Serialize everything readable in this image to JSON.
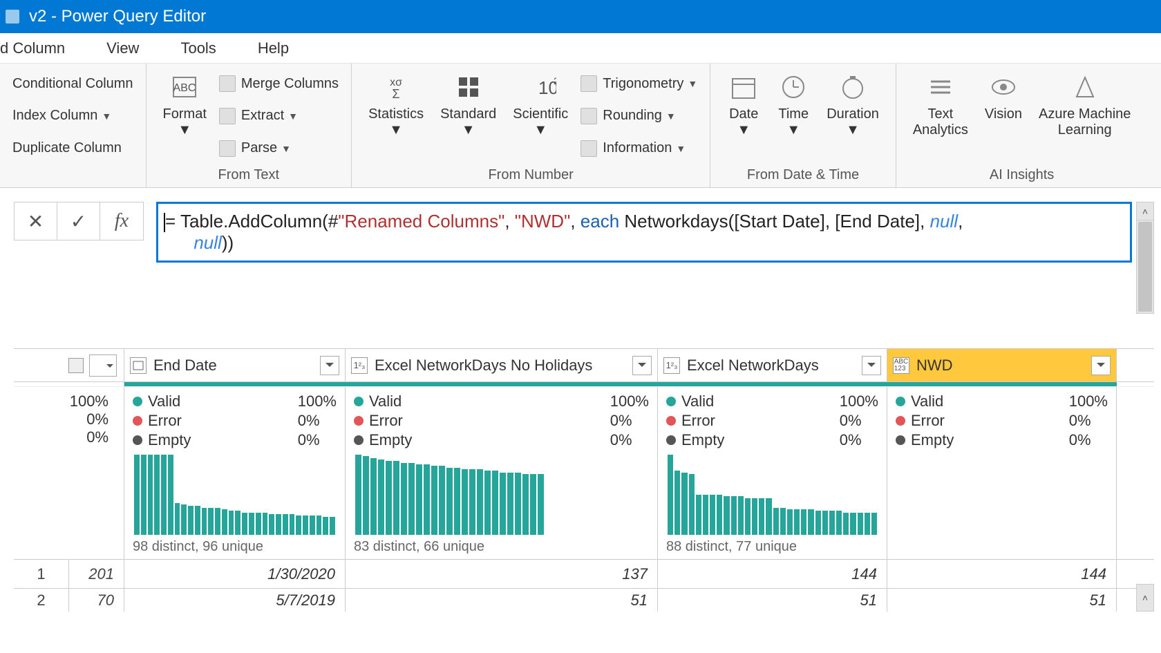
{
  "window": {
    "title": "v2 - Power Query Editor"
  },
  "menu": {
    "items": [
      "d Column",
      "View",
      "Tools",
      "Help"
    ]
  },
  "ribbon": {
    "col_group": {
      "conditional": "Conditional Column",
      "index": "Index Column",
      "duplicate": "Duplicate Column"
    },
    "text_group": {
      "format": "Format",
      "merge": "Merge Columns",
      "extract": "Extract",
      "parse": "Parse",
      "label": "From Text"
    },
    "number_group": {
      "statistics": "Statistics",
      "standard": "Standard",
      "scientific": "Scientific",
      "trig": "Trigonometry",
      "rounding": "Rounding",
      "information": "Information",
      "label": "From Number"
    },
    "datetime_group": {
      "date": "Date",
      "time": "Time",
      "duration": "Duration",
      "label": "From Date & Time"
    },
    "ai_group": {
      "ta": "Text\nAnalytics",
      "vision": "Vision",
      "aml": "Azure Machine\nLearning",
      "label": "AI Insights"
    }
  },
  "formula": {
    "pre": "= Table.AddColumn(#",
    "step_name": "\"Renamed Columns\"",
    "mid1": ", ",
    "new_col": "\"NWD\"",
    "mid2": ", ",
    "each_kw": "each",
    "mid3": " Networkdays([Start Date], [End Date], ",
    "null1": "null",
    "mid4": ",\n      ",
    "null2": "null",
    "tail": "))"
  },
  "columns": [
    {
      "type": "date",
      "name": "End Date",
      "valid_pct": "100%",
      "error_pct": "0%",
      "empty_pct": "0%",
      "distinct": "98 distinct, 96 unique"
    },
    {
      "type": "123",
      "name": "Excel NetworkDays No Holidays",
      "valid_pct": "100%",
      "error_pct": "0%",
      "empty_pct": "0%",
      "distinct": "83 distinct, 66 unique"
    },
    {
      "type": "123",
      "name": "Excel NetworkDays",
      "valid_pct": "100%",
      "error_pct": "0%",
      "empty_pct": "0%",
      "distinct": "88 distinct, 77 unique"
    },
    {
      "type": "abc123",
      "name": "NWD",
      "valid_pct": "100%",
      "error_pct": "0%",
      "empty_pct": "0%",
      "distinct": ""
    }
  ],
  "labels": {
    "valid": "Valid",
    "error": "Error",
    "empty": "Empty"
  },
  "row0_left_pct": "100%",
  "row0_zeros": [
    "0%",
    "0%"
  ],
  "rows": [
    {
      "n": "1",
      "c0_left": "201",
      "cells": [
        "1/30/2020",
        "137",
        "144",
        "144"
      ]
    },
    {
      "n": "2",
      "c0_left": "70",
      "cells": [
        "5/7/2019",
        "51",
        "51",
        "51"
      ]
    }
  ],
  "chart_data": [
    {
      "type": "bar",
      "title": "End Date distribution",
      "values": [
        100,
        100,
        100,
        100,
        100,
        100,
        40,
        38,
        36,
        36,
        34,
        34,
        34,
        32,
        30,
        30,
        28,
        28,
        28,
        28,
        26,
        26,
        26,
        26,
        24,
        24,
        24,
        24,
        22,
        22
      ],
      "ylim": [
        0,
        100
      ]
    },
    {
      "type": "bar",
      "title": "Excel NetworkDays No Holidays distribution",
      "values": [
        100,
        98,
        96,
        94,
        92,
        92,
        90,
        90,
        88,
        88,
        86,
        86,
        84,
        84,
        82,
        82,
        82,
        80,
        80,
        78,
        78,
        78,
        76,
        76,
        76
      ],
      "ylim": [
        0,
        100
      ]
    },
    {
      "type": "bar",
      "title": "Excel NetworkDays distribution",
      "values": [
        100,
        80,
        78,
        76,
        50,
        50,
        50,
        50,
        48,
        48,
        48,
        46,
        46,
        46,
        46,
        34,
        34,
        32,
        32,
        32,
        32,
        30,
        30,
        30,
        30,
        28,
        28,
        28,
        28,
        28
      ],
      "ylim": [
        0,
        100
      ]
    }
  ]
}
